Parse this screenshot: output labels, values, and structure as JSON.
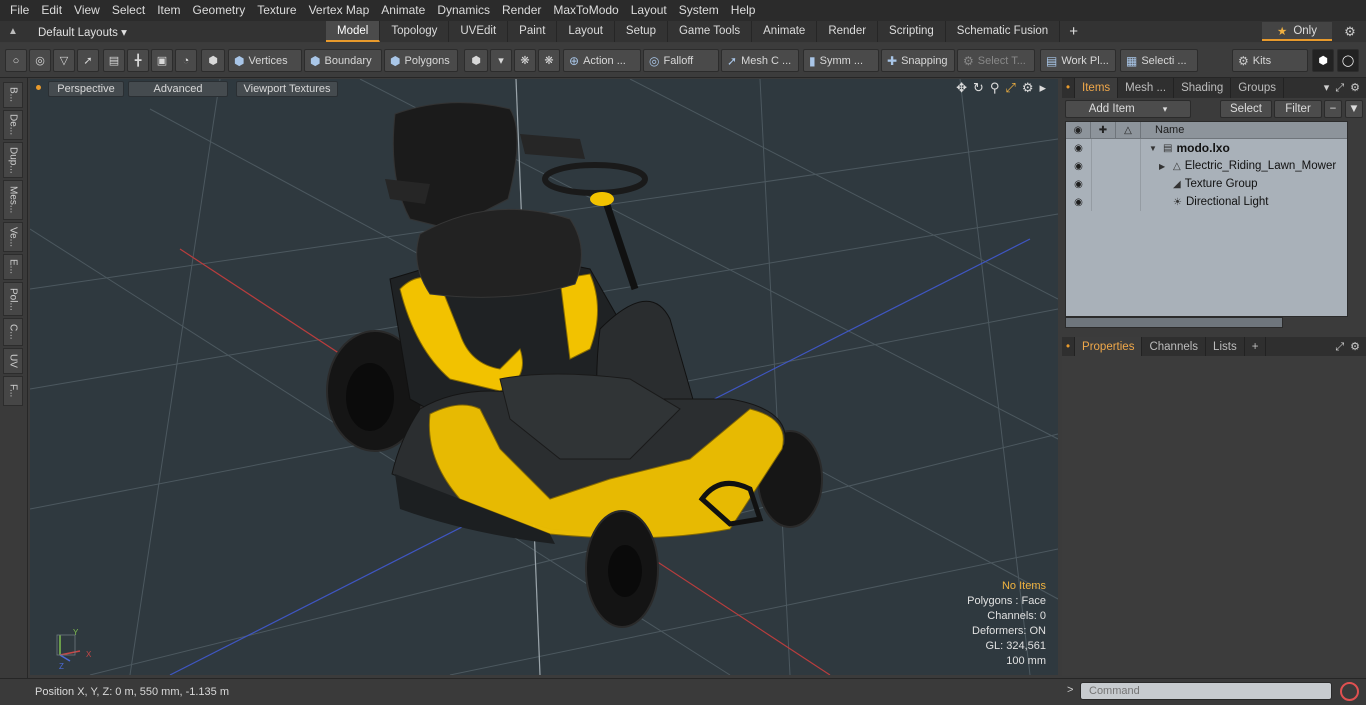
{
  "menu": [
    "File",
    "Edit",
    "View",
    "Select",
    "Item",
    "Geometry",
    "Texture",
    "Vertex Map",
    "Animate",
    "Dynamics",
    "Render",
    "MaxToModo",
    "Layout",
    "System",
    "Help"
  ],
  "layout_selector": "Default Layouts ▾",
  "tabs": [
    {
      "label": "Model",
      "active": true
    },
    {
      "label": "Topology"
    },
    {
      "label": "UVEdit"
    },
    {
      "label": "Paint"
    },
    {
      "label": "Layout"
    },
    {
      "label": "Setup"
    },
    {
      "label": "Game Tools"
    },
    {
      "label": "Animate"
    },
    {
      "label": "Render"
    },
    {
      "label": "Scripting"
    },
    {
      "label": "Schematic Fusion"
    }
  ],
  "tab_plus": "+",
  "only_label": "Only",
  "toolbar": {
    "vertices": "Vertices",
    "boundary": "Boundary",
    "polygons": "Polygons",
    "action": "Action ...",
    "falloff": "Falloff",
    "mesh_c": "Mesh C ...",
    "symm": "Symm ...",
    "snapping": "Snapping",
    "select_t": "Select T...",
    "work_pl": "Work Pl...",
    "selecti": "Selecti ...",
    "kits": "Kits"
  },
  "left_tabs": [
    "B...",
    "De...",
    "Dup...",
    "Mes...",
    "Ve...",
    "E...",
    "Pol...",
    "C...",
    "UV",
    "F..."
  ],
  "viewport": {
    "perspective": "Perspective",
    "advanced": "Advanced",
    "viewport_textures": "Viewport Textures",
    "info": {
      "no_items": "No Items",
      "polygons": "Polygons : Face",
      "channels": "Channels: 0",
      "deformers": "Deformers: ON",
      "gl": "GL: 324,561",
      "scale": "100 mm"
    },
    "axis_labels": {
      "y": "Y",
      "x": "X",
      "z": "Z"
    }
  },
  "status": "Position X, Y, Z:   0 m, 550 mm, -1.135 m",
  "items_panel": {
    "tabs": [
      {
        "label": "Items",
        "active": true
      },
      {
        "label": "Mesh ..."
      },
      {
        "label": "Shading"
      },
      {
        "label": "Groups"
      }
    ],
    "add_item": "Add Item",
    "select": "Select",
    "filter": "Filter",
    "column_name": "Name",
    "rows": [
      {
        "label": "modo.lxo",
        "bold": true
      },
      {
        "label": "Electric_Riding_Lawn_Mower"
      },
      {
        "label": "Texture Group"
      },
      {
        "label": "Directional Light"
      }
    ]
  },
  "props_panel": {
    "tabs": [
      {
        "label": "Properties",
        "active": true
      },
      {
        "label": "Channels"
      },
      {
        "label": "Lists"
      }
    ],
    "plus": "+"
  },
  "command": {
    "placeholder": "Command"
  },
  "colors": {
    "accent": "#e89a2c",
    "mower_yellow": "#f2c200",
    "viewport_bg": "#2f393f"
  }
}
